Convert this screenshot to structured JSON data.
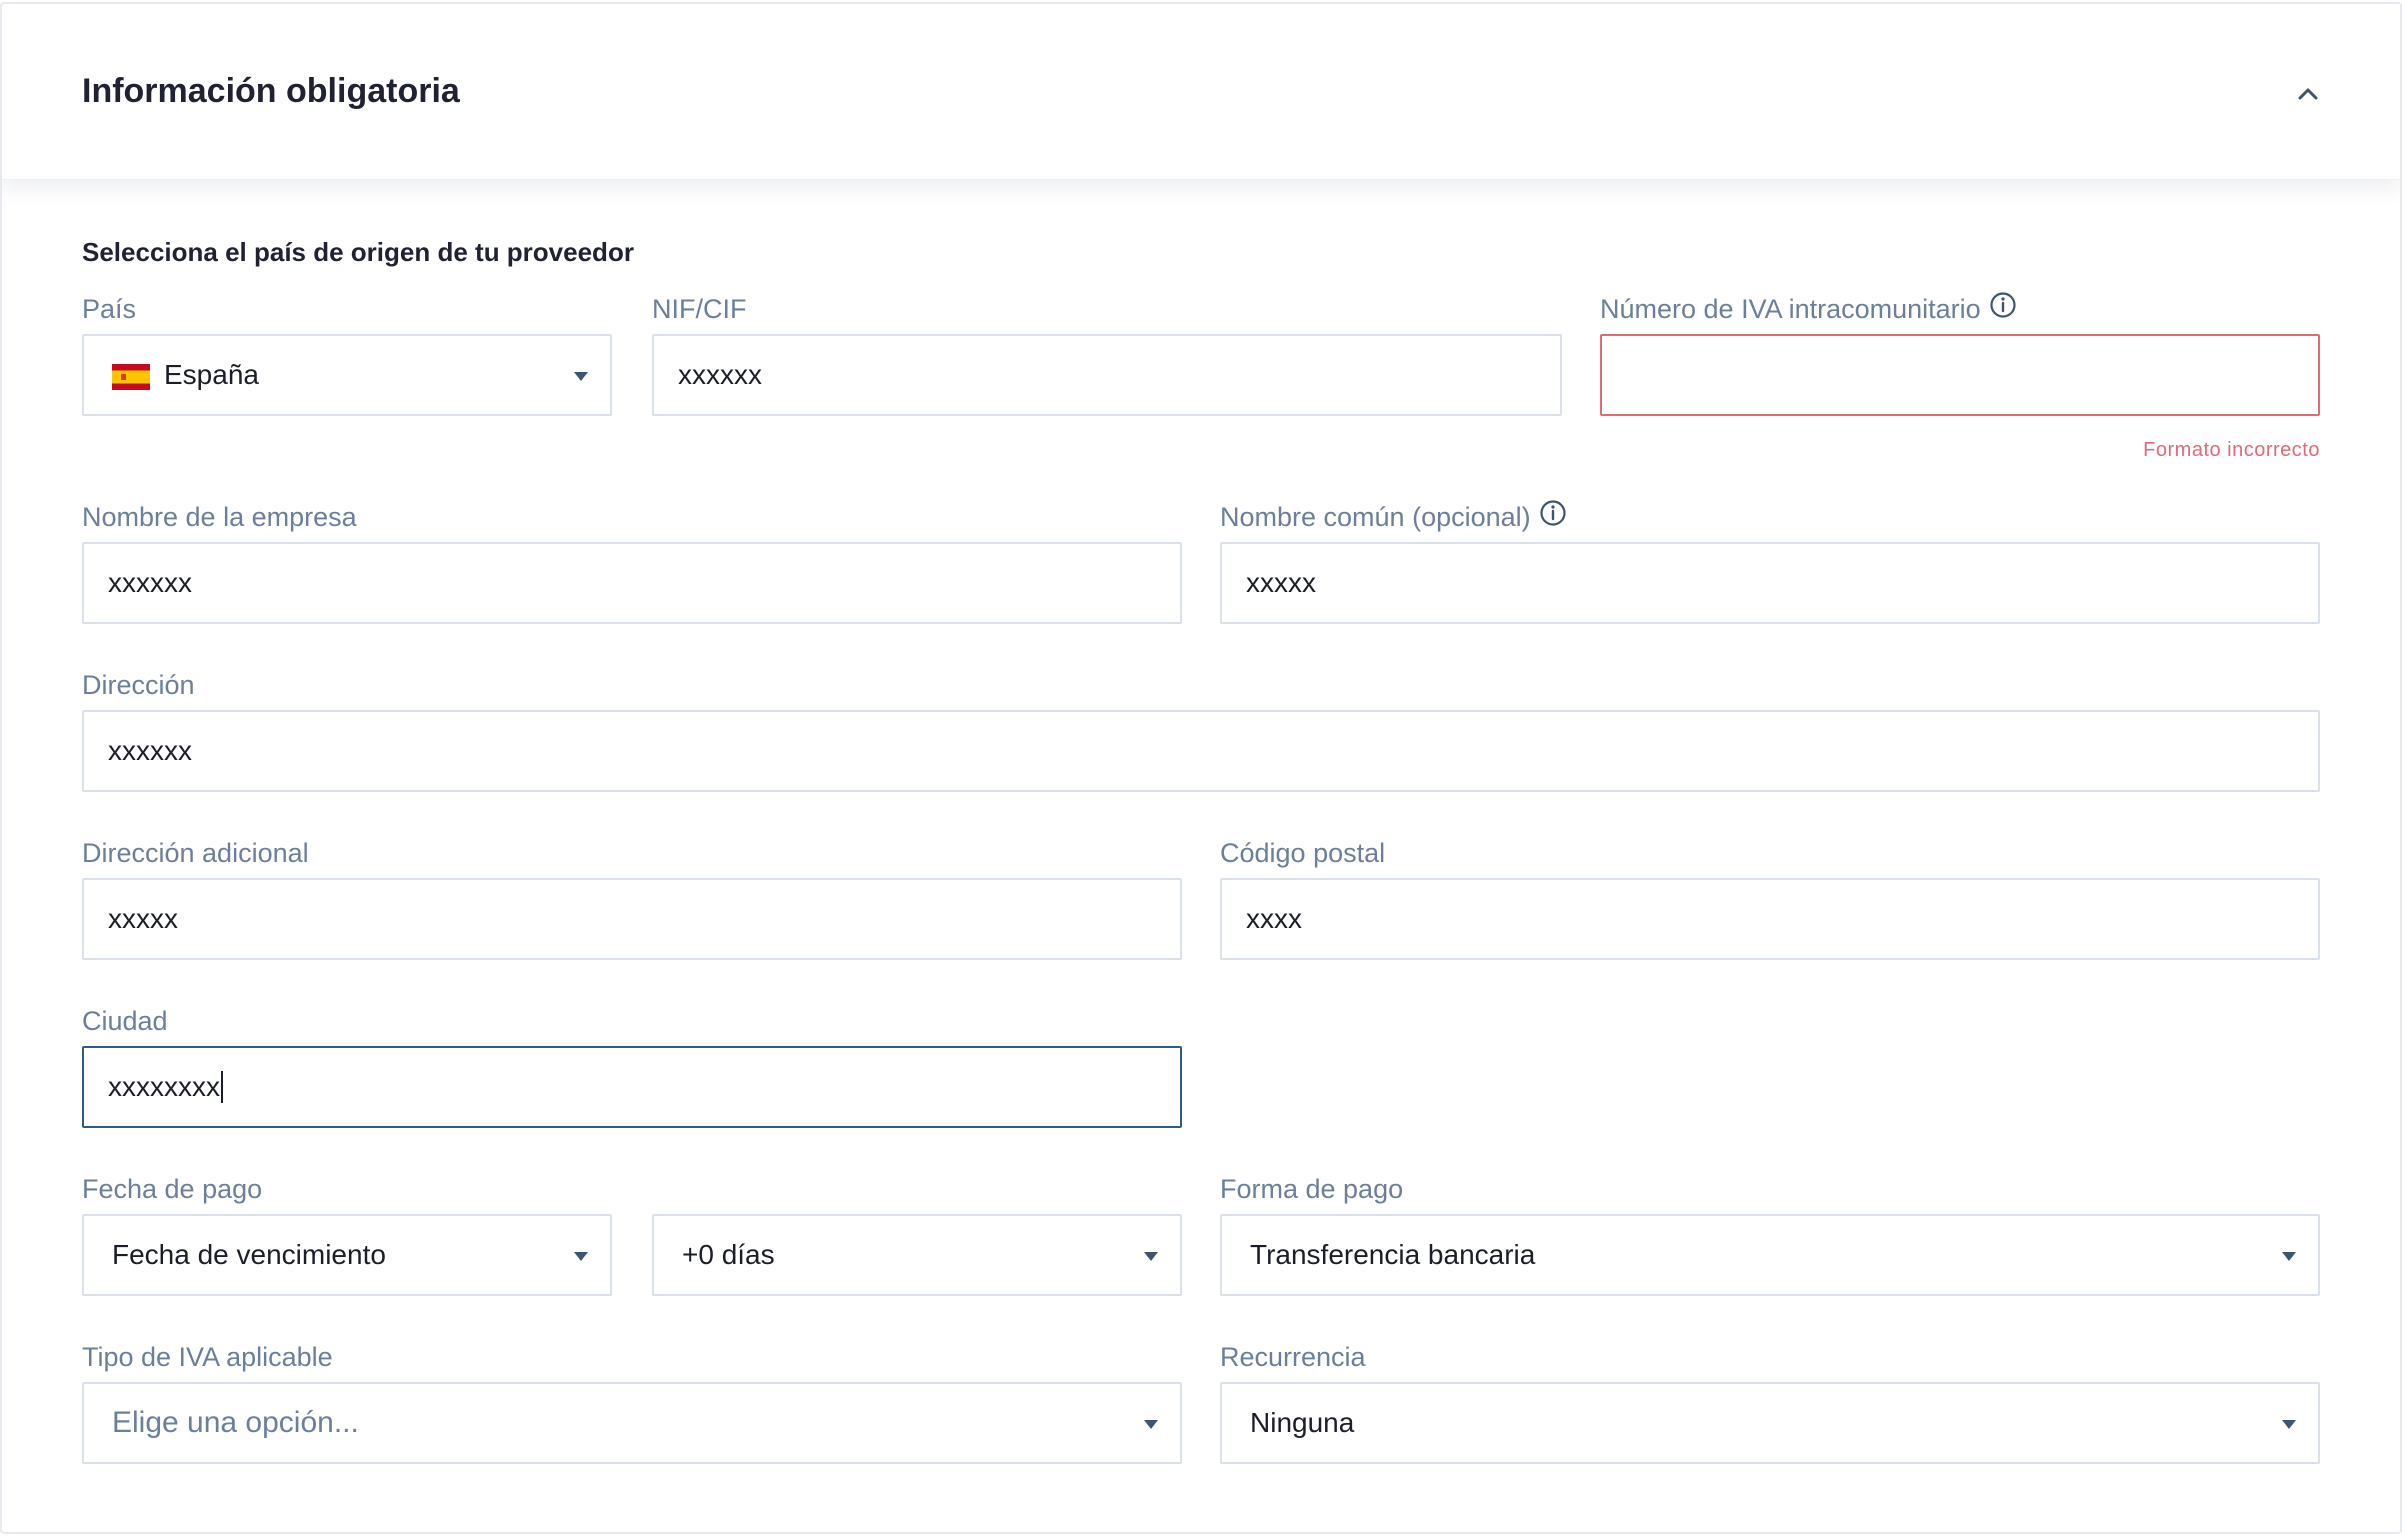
{
  "section": {
    "title": "Información obligatoria",
    "subtitle": "Selecciona el país de origen de tu proveedor"
  },
  "colors": {
    "label": "#6c7f9a",
    "error": "#e26a78",
    "focus_border": "#2e5c8a",
    "border": "#dbe1ea",
    "caret": "#3d5473"
  },
  "icons": {
    "collapse": "chevron-up-icon",
    "info": "info-circle-icon",
    "dropdown": "caret-down-icon",
    "country_flag": "spain-flag-icon"
  },
  "fields": {
    "pais": {
      "label": "País",
      "value": "España"
    },
    "nif": {
      "label": "NIF/CIF",
      "value": "xxxxxx"
    },
    "iva_intracomunitario": {
      "label": "Número de IVA intracomunitario",
      "value": "",
      "error": "Formato incorrecto"
    },
    "nombre_empresa": {
      "label": "Nombre de la empresa",
      "value": "xxxxxx"
    },
    "nombre_comun": {
      "label": "Nombre común (opcional)",
      "value": "xxxxx"
    },
    "direccion": {
      "label": "Dirección",
      "value": "xxxxxx"
    },
    "direccion_adicional": {
      "label": "Dirección adicional",
      "value": "xxxxx"
    },
    "codigo_postal": {
      "label": "Código postal",
      "value": "xxxx"
    },
    "ciudad": {
      "label": "Ciudad",
      "value": "xxxxxxxx"
    },
    "fecha_pago": {
      "label": "Fecha de pago",
      "value": "Fecha de vencimiento",
      "offset": "+0 días"
    },
    "forma_pago": {
      "label": "Forma de pago",
      "value": "Transferencia bancaria"
    },
    "tipo_iva": {
      "label": "Tipo de IVA aplicable",
      "placeholder": "Elige una opción..."
    },
    "recurrencia": {
      "label": "Recurrencia",
      "value": "Ninguna"
    }
  }
}
